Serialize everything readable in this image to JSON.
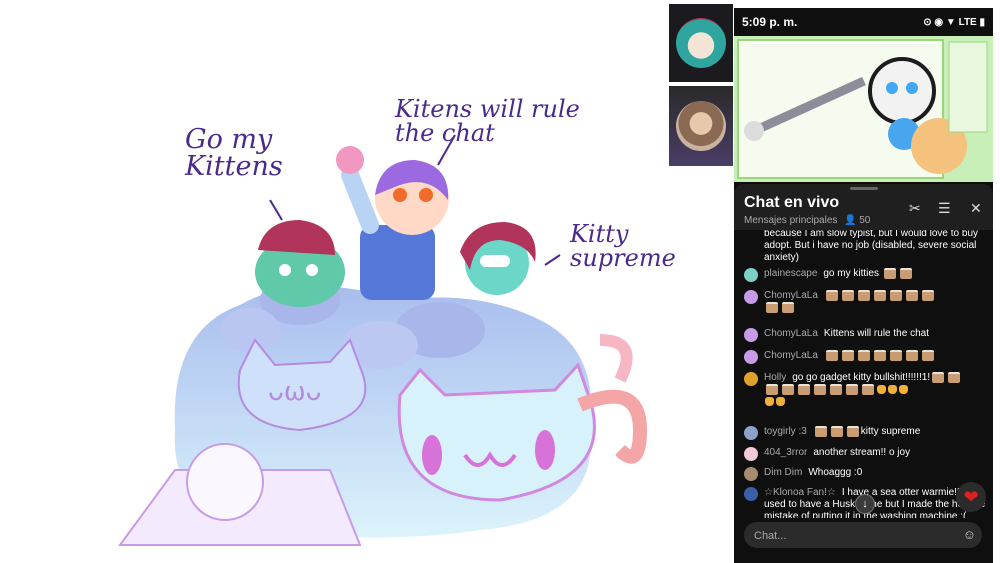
{
  "canvas": {
    "text_go": "Go my\nKittens",
    "text_kitens": "Kitens will rule\nthe chat",
    "text_kitty": "Kitty\nsupreme"
  },
  "cams": [
    {
      "name": "cam-1"
    },
    {
      "name": "cam-2"
    }
  ],
  "status": {
    "time": "5:09 p. m.",
    "icons": "⊙ ◉ ▼ LTE ▮"
  },
  "chat": {
    "title": "Chat en vivo",
    "subtitle": "Mensajes principales",
    "viewers": "50",
    "input_placeholder": "Chat...",
    "messages": [
      {
        "user": "",
        "text": "because I am slow typist, but I would love to buy adopt. But i have no job (disabled, severe social anxiety)"
      },
      {
        "user": "plainescape",
        "text": "go my kitties"
      },
      {
        "user": "ChomyLaLa",
        "text": ""
      },
      {
        "user": "ChomyLaLa",
        "text": "Kittens will rule the chat"
      },
      {
        "user": "ChomyLaLa",
        "text": ""
      },
      {
        "user": "Holly",
        "text": "go go gadget kitty bullshit!!!!!!1!"
      },
      {
        "user": "toygirly :3",
        "text": "kitty supreme"
      },
      {
        "user": "404_3rror",
        "text": "another stream!! o joy"
      },
      {
        "user": "Dim Dim",
        "text": "Whoaggg :0"
      },
      {
        "user": "☆Klonoa Fan!☆",
        "text": "I have a sea otter warmie!! I used to have a Huskie one but I made the horrible mistake of putting it in the washing machine :("
      }
    ]
  }
}
